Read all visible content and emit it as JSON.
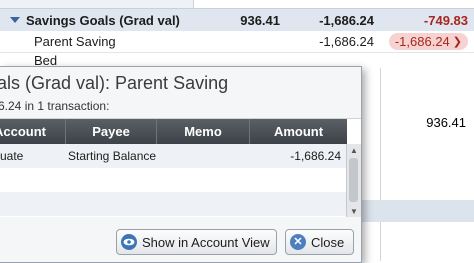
{
  "budget_grid": {
    "group_row": {
      "label": "Savings Goals (Grad val)",
      "col1": "936.41",
      "col2": "-1,686.24",
      "col3": "-749.83"
    },
    "sub_row": {
      "label": "Parent Saving",
      "col2": "-1,686.24",
      "col3": "-1,686.24"
    },
    "row3": {
      "label": "Bed"
    },
    "lower_value": "936.41"
  },
  "popup": {
    "title": "als (Grad val): Parent Saving",
    "summary": "6.24 in 1 transaction:",
    "columns": {
      "account": "Account",
      "payee": "Payee",
      "memo": "Memo",
      "amount": "Amount"
    },
    "rows": [
      {
        "account": "uate",
        "payee": "Starting Balance",
        "memo": "",
        "amount": "-1,686.24"
      }
    ],
    "buttons": {
      "show": "Show in Account View",
      "close": "Close"
    }
  },
  "colors": {
    "negative": "#a8261f",
    "negative_pill_bg": "#f6d3d0",
    "header_dark": "#3d4248",
    "accent": "#3d74b8"
  }
}
